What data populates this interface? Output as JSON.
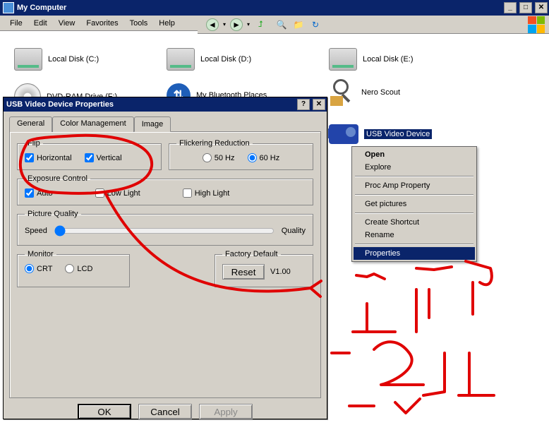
{
  "window": {
    "title": "My Computer",
    "menu": [
      "File",
      "Edit",
      "View",
      "Favorites",
      "Tools",
      "Help"
    ]
  },
  "drives": {
    "c": "Local Disk (C:)",
    "d": "Local Disk (D:)",
    "e": "Local Disk (E:)",
    "dvd": "DVD-RAM Drive (F:)",
    "bt": "My Bluetooth Places",
    "scout": "Nero Scout",
    "usbcam": "USB Video Device"
  },
  "dialog": {
    "title": "USB Video Device Properties",
    "tabs": {
      "general": "General",
      "color": "Color Management",
      "image": "Image"
    },
    "flip": {
      "legend": "Flip",
      "horizontal": "Horizontal",
      "vertical": "Vertical"
    },
    "flicker": {
      "legend": "Flickering Reduction",
      "hz50": "50 Hz",
      "hz60": "60 Hz"
    },
    "exposure": {
      "legend": "Exposure Control",
      "auto": "Auto",
      "low": "Low Light",
      "high": "High Light"
    },
    "picture": {
      "legend": "Picture Quality",
      "speed": "Speed",
      "quality": "Quality"
    },
    "monitor": {
      "legend": "Monitor",
      "crt": "CRT",
      "lcd": "LCD"
    },
    "factory": {
      "legend": "Factory Default",
      "reset": "Reset",
      "version": "V1.00"
    },
    "buttons": {
      "ok": "OK",
      "cancel": "Cancel",
      "apply": "Apply"
    }
  },
  "context_menu": {
    "open": "Open",
    "explore": "Explore",
    "proc": "Proc Amp Property",
    "getpics": "Get pictures",
    "shortcut": "Create Shortcut",
    "rename": "Rename",
    "properties": "Properties"
  }
}
